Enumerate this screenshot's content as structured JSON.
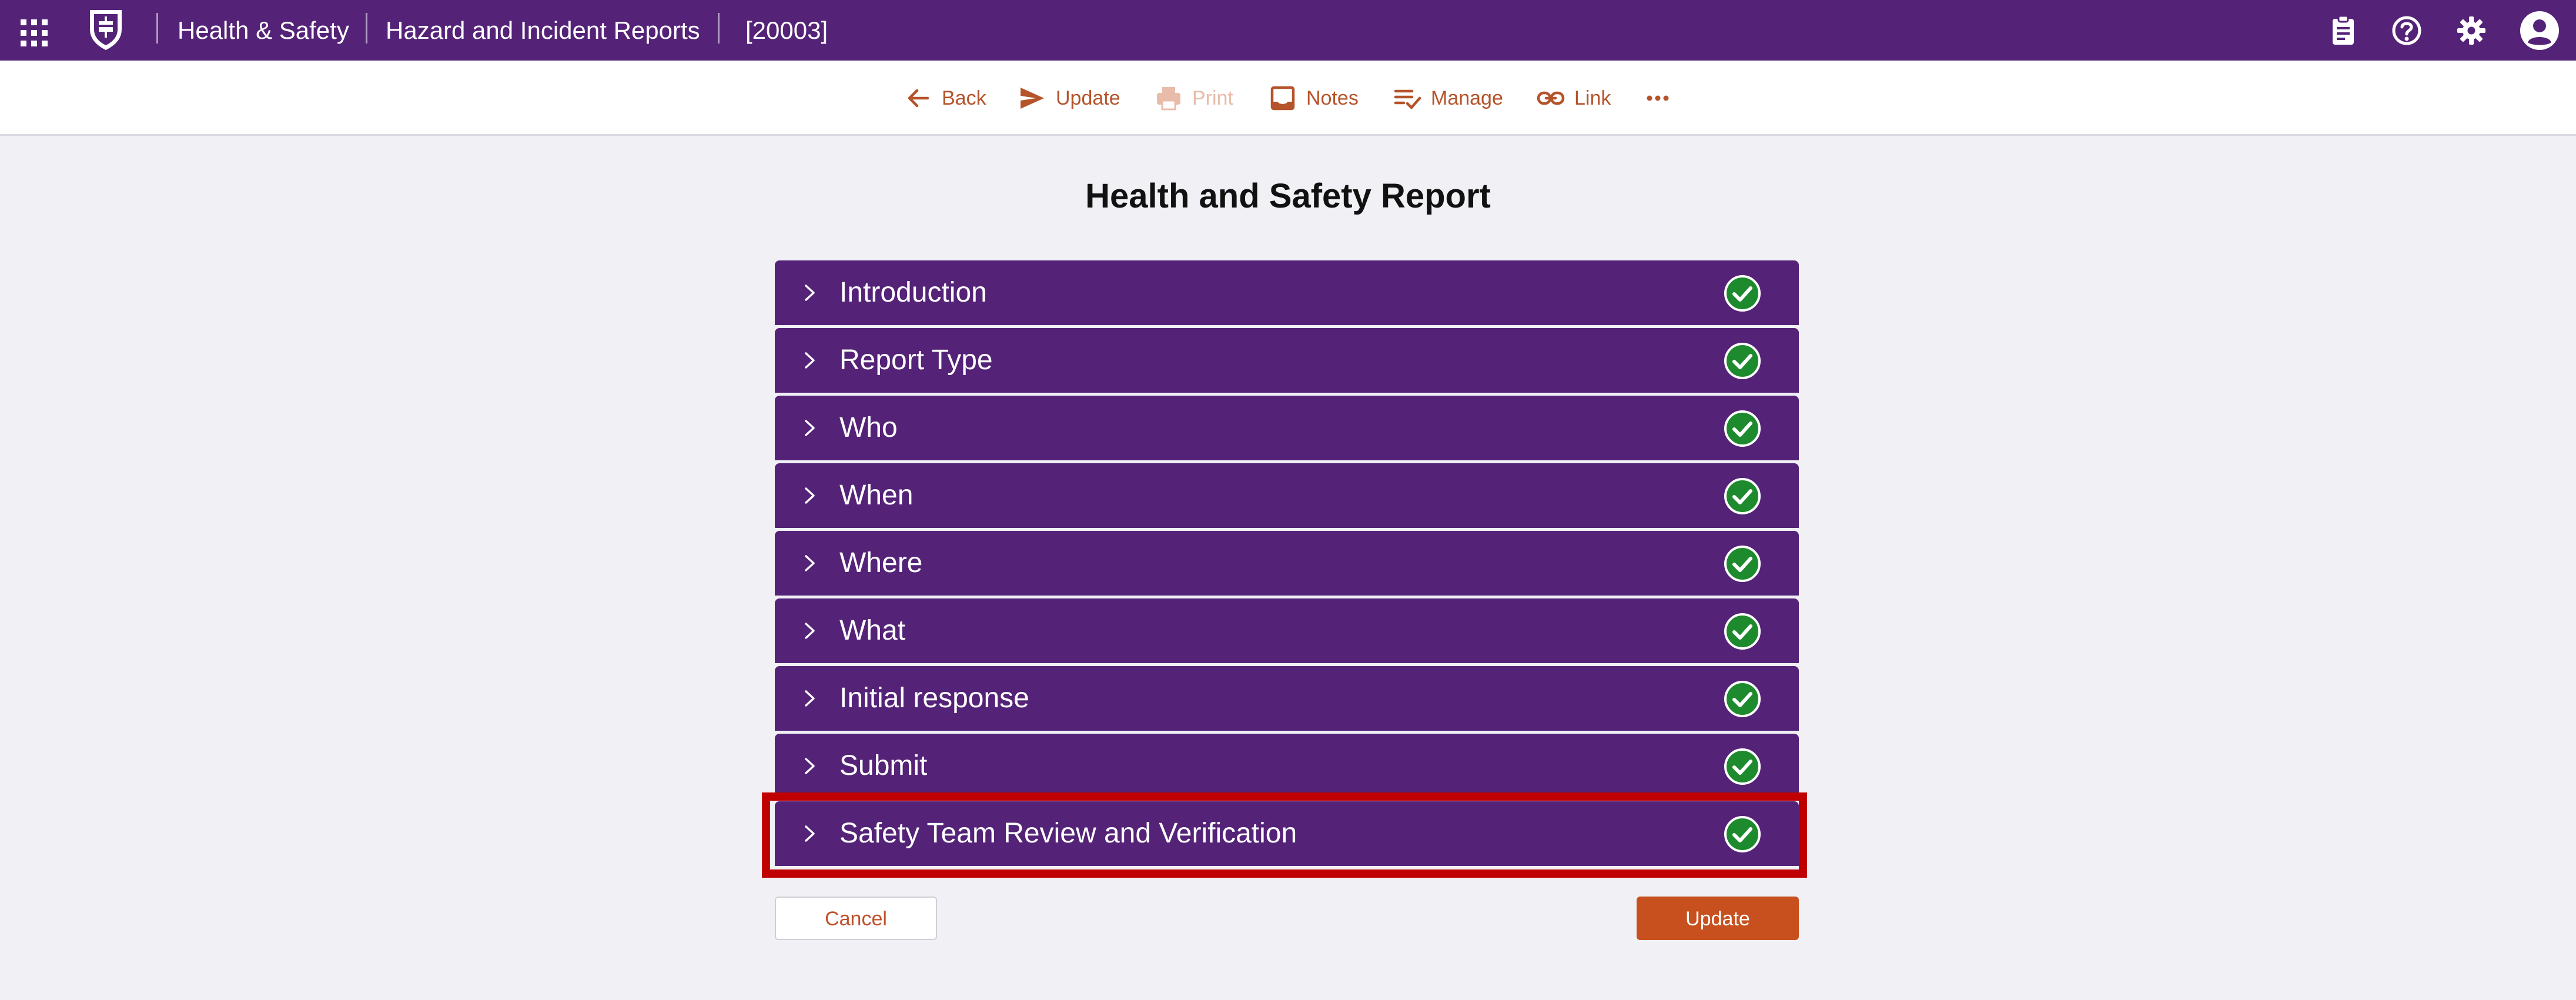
{
  "appbar": {
    "breadcrumbs": [
      "Health & Safety",
      "Hazard and Incident Reports",
      "[20003]"
    ],
    "icons": [
      "apps-grid-icon",
      "crest-logo",
      "clipboard-icon",
      "help-icon",
      "gear-icon",
      "account-icon"
    ]
  },
  "toolbar": {
    "back": "Back",
    "update": "Update",
    "print": "Print",
    "notes": "Notes",
    "manage": "Manage",
    "link": "Link"
  },
  "main": {
    "title": "Health and Safety Report",
    "sections": [
      {
        "label": "Introduction",
        "status": "complete"
      },
      {
        "label": "Report Type",
        "status": "complete"
      },
      {
        "label": "Who",
        "status": "complete"
      },
      {
        "label": "When",
        "status": "complete"
      },
      {
        "label": "Where",
        "status": "complete"
      },
      {
        "label": "What",
        "status": "complete"
      },
      {
        "label": "Initial response",
        "status": "complete"
      },
      {
        "label": "Submit",
        "status": "complete"
      },
      {
        "label": "Safety Team Review and Verification",
        "status": "complete"
      }
    ],
    "cancel_label": "Cancel",
    "update_label": "Update"
  },
  "colors": {
    "brand_purple": "#542378",
    "accent_orange": "#c7501e",
    "check_green": "#1e8a2e",
    "highlight_red": "#c00000"
  }
}
